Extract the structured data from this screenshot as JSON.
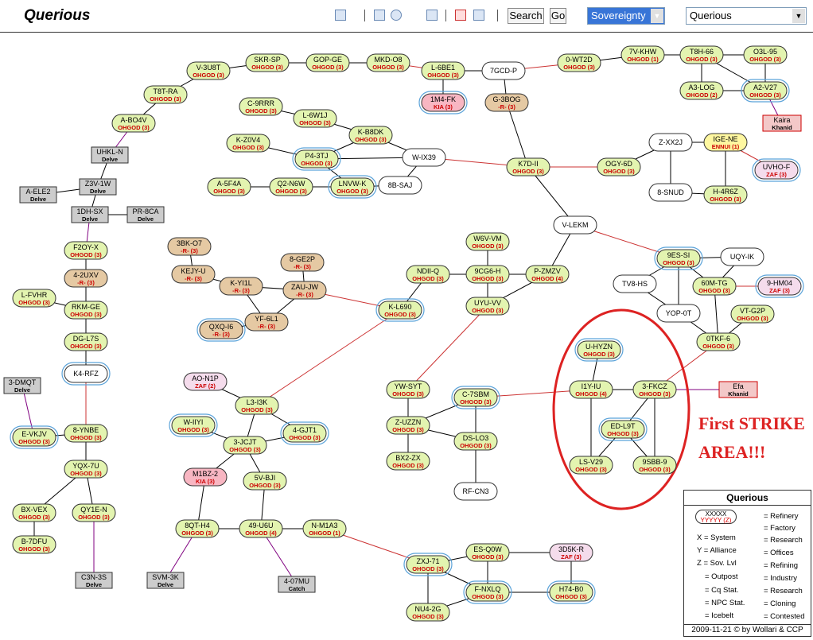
{
  "header": {
    "title": "Querious",
    "search_label": "Search",
    "go_label": "Go",
    "map_mode": "Sovereignty",
    "region_select": "Querious"
  },
  "annotation": {
    "line1": "First STRIKE",
    "line2": "AREA!!!"
  },
  "legend": {
    "title": "Querious",
    "sample_name": "XXXXX",
    "sample_ally": "YYYYY (Z)",
    "key_system": "X = System",
    "key_alliance": "Y = Alliance",
    "key_sov": "Z = Sov. Lvl",
    "key_outpost": "= Outpost",
    "key_cq": "= Cq Stat.",
    "key_npc": "= NPC Stat.",
    "key_icebelt": "= Icebelt",
    "key_refinery": "= Refinery",
    "key_factory": "= Factory",
    "key_research": "= Research",
    "key_offices": "= Offices",
    "key_refining": "= Refining",
    "key_industry": "= Industry",
    "key_research2": "= Research",
    "key_cloning": "= Cloning",
    "key_contested": "= Contested",
    "footer": "2009-11-21 © by Wollari & CCP"
  },
  "colors": {
    "ohgod": "#e3f4b0",
    "red_r": "#e5c9a3",
    "contested": "#f8b6c2",
    "zaf": "#f5dcec",
    "ennui": "#fef7a0",
    "box": "#cccccc",
    "red_line": "#cc3333",
    "purple_line": "#800080"
  },
  "systems": [
    {
      "id": "V-3U8T",
      "label": "OHGOD (3)",
      "c": "g"
    },
    {
      "id": "SKR-SP",
      "label": "OHGOD (3)",
      "c": "g"
    },
    {
      "id": "GOP-GE",
      "label": "OHGOD (3)",
      "c": "g"
    },
    {
      "id": "MKD-O8",
      "label": "OHGOD (3)",
      "c": "g"
    },
    {
      "id": "L-6BE1",
      "label": "OHGOD (3)",
      "c": "g"
    },
    {
      "id": "7GCD-P",
      "label": "",
      "c": "w"
    },
    {
      "id": "0-WT2D",
      "label": "OHGOD (3)",
      "c": "g"
    },
    {
      "id": "7V-KHW",
      "label": "OHGOD (1)",
      "c": "g"
    },
    {
      "id": "T8H-66",
      "label": "OHGOD (3)",
      "c": "g"
    },
    {
      "id": "O3L-95",
      "label": "OHGOD (3)",
      "c": "g"
    },
    {
      "id": "A3-LOG",
      "label": "OHGOD (2)",
      "c": "g"
    },
    {
      "id": "A2-V27",
      "label": "OHGOD (3)",
      "c": "g",
      "ice": 1
    },
    {
      "id": "T8T-RA",
      "label": "OHGOD (3)",
      "c": "g"
    },
    {
      "id": "A-BO4V",
      "label": "OHGOD (3)",
      "c": "g"
    },
    {
      "id": "1M4-FK",
      "label": "KIA (3)",
      "c": "p",
      "ice": 1
    },
    {
      "id": "G-3BOG",
      "label": "-R- (3)",
      "c": "r"
    },
    {
      "id": "C-9RRR",
      "label": "OHGOD (3)",
      "c": "g"
    },
    {
      "id": "L-6W1J",
      "label": "OHGOD (3)",
      "c": "g"
    },
    {
      "id": "K-B8DK",
      "label": "OHGOD (3)",
      "c": "g"
    },
    {
      "id": "K-Z0V4",
      "label": "OHGOD (3)",
      "c": "g"
    },
    {
      "id": "P4-3TJ",
      "label": "OHGOD (3)",
      "c": "g",
      "ice": 1
    },
    {
      "id": "W-IX39",
      "label": "",
      "c": "w"
    },
    {
      "id": "K7D-II",
      "label": "OHGOD (3)",
      "c": "g"
    },
    {
      "id": "Z-XX2J",
      "label": "",
      "c": "w"
    },
    {
      "id": "IGE-NE",
      "label": "ENNUI (1)",
      "c": "y"
    },
    {
      "id": "OGY-6D",
      "label": "OHGOD (3)",
      "c": "g"
    },
    {
      "id": "UVHO-F",
      "label": "ZAF (3)",
      "c": "z",
      "ice": 1
    },
    {
      "id": "A-5F4A",
      "label": "OHGOD (3)",
      "c": "g"
    },
    {
      "id": "Q2-N6W",
      "label": "OHGOD (3)",
      "c": "g"
    },
    {
      "id": "LNVW-K",
      "label": "OHGOD (3)",
      "c": "g",
      "ice": 1
    },
    {
      "id": "8B-SAJ",
      "label": "",
      "c": "w"
    },
    {
      "id": "8-SNUD",
      "label": "",
      "c": "w"
    },
    {
      "id": "H-4R6Z",
      "label": "OHGOD (3)",
      "c": "g"
    },
    {
      "id": "V-LEKM",
      "label": "",
      "c": "w"
    },
    {
      "id": "F2OY-X",
      "label": "OHGOD (3)",
      "c": "g"
    },
    {
      "id": "3BK-O7",
      "label": "-R- (3)",
      "c": "r"
    },
    {
      "id": "W6V-VM",
      "label": "OHGOD (3)",
      "c": "g"
    },
    {
      "id": "8-GE2P",
      "label": "-R- (3)",
      "c": "r"
    },
    {
      "id": "KEJY-U",
      "label": "-R- (3)",
      "c": "r"
    },
    {
      "id": "4-2UXV",
      "label": "-R- (3)",
      "c": "r"
    },
    {
      "id": "NDII-Q",
      "label": "OHGOD (3)",
      "c": "g"
    },
    {
      "id": "9CG6-H",
      "label": "OHGOD (3)",
      "c": "g"
    },
    {
      "id": "P-ZMZV",
      "label": "OHGOD (4)",
      "c": "g"
    },
    {
      "id": "9ES-SI",
      "label": "OHGOD (3)",
      "c": "g",
      "ice": 1
    },
    {
      "id": "UQY-IK",
      "label": "",
      "c": "w"
    },
    {
      "id": "K-YI1L",
      "label": "-R- (3)",
      "c": "r"
    },
    {
      "id": "ZAU-JW",
      "label": "-R- (3)",
      "c": "r"
    },
    {
      "id": "L-FVHR",
      "label": "OHGOD (3)",
      "c": "g"
    },
    {
      "id": "TV8-HS",
      "label": "",
      "c": "w"
    },
    {
      "id": "60M-TG",
      "label": "OHGOD (3)",
      "c": "g"
    },
    {
      "id": "9-HM04",
      "label": "ZAF (3)",
      "c": "z",
      "ice": 1
    },
    {
      "id": "RKM-GE",
      "label": "OHGOD (3)",
      "c": "g"
    },
    {
      "id": "UYU-VV",
      "label": "OHGOD (3)",
      "c": "g"
    },
    {
      "id": "K-L690",
      "label": "OHGOD (3)",
      "c": "g",
      "ice": 1
    },
    {
      "id": "YOP-0T",
      "label": "",
      "c": "w"
    },
    {
      "id": "VT-G2P",
      "label": "OHGOD (3)",
      "c": "g"
    },
    {
      "id": "YF-6L1",
      "label": "-R- (3)",
      "c": "r"
    },
    {
      "id": "QXQ-I6",
      "label": "-R- (3)",
      "c": "r",
      "ice": 1
    },
    {
      "id": "DG-L7S",
      "label": "OHGOD (3)",
      "c": "g"
    },
    {
      "id": "0TKF-6",
      "label": "OHGOD (3)",
      "c": "g"
    },
    {
      "id": "U-HYZN",
      "label": "OHGOD (3)",
      "c": "g",
      "ice": 1
    },
    {
      "id": "K4-RFZ",
      "label": "",
      "c": "w",
      "ice": 1
    },
    {
      "id": "AO-N1P",
      "label": "ZAF (2)",
      "c": "z"
    },
    {
      "id": "YW-SYT",
      "label": "OHGOD (3)",
      "c": "g"
    },
    {
      "id": "I1Y-IU",
      "label": "OHGOD (4)",
      "c": "g"
    },
    {
      "id": "3-FKCZ",
      "label": "OHGOD (3)",
      "c": "g"
    },
    {
      "id": "C-7SBM",
      "label": "OHGOD (3)",
      "c": "g",
      "ice": 1
    },
    {
      "id": "L3-I3K",
      "label": "OHGOD (3)",
      "c": "g"
    },
    {
      "id": "W-IIYI",
      "label": "OHGOD (3)",
      "c": "g",
      "ice": 1
    },
    {
      "id": "4-GJT1",
      "label": "OHGOD (3)",
      "c": "g",
      "ice": 1
    },
    {
      "id": "Z-UZZN",
      "label": "OHGOD (3)",
      "c": "g"
    },
    {
      "id": "E-VKJV",
      "label": "OHGOD (3)",
      "c": "g",
      "ice": 1
    },
    {
      "id": "8-YNBE",
      "label": "OHGOD (3)",
      "c": "g"
    },
    {
      "id": "ED-L9T",
      "label": "OHGOD (3)",
      "c": "g",
      "ice": 1
    },
    {
      "id": "3-JCJT",
      "label": "OHGOD (3)",
      "c": "g"
    },
    {
      "id": "DS-LO3",
      "label": "OHGOD (3)",
      "c": "g"
    },
    {
      "id": "BX2-ZX",
      "label": "OHGOD (3)",
      "c": "g"
    },
    {
      "id": "YQX-7U",
      "label": "OHGOD (3)",
      "c": "g"
    },
    {
      "id": "LS-V29",
      "label": "OHGOD (3)",
      "c": "g"
    },
    {
      "id": "9SBB-9",
      "label": "OHGOD (3)",
      "c": "g"
    },
    {
      "id": "M1BZ-2",
      "label": "KIA (3)",
      "c": "p"
    },
    {
      "id": "5V-BJI",
      "label": "OHGOD (3)",
      "c": "g"
    },
    {
      "id": "RF-CN3",
      "label": "",
      "c": "w"
    },
    {
      "id": "BX-VEX",
      "label": "OHGOD (3)",
      "c": "g"
    },
    {
      "id": "QY1E-N",
      "label": "OHGOD (3)",
      "c": "g"
    },
    {
      "id": "8QT-H4",
      "label": "OHGOD (3)",
      "c": "g"
    },
    {
      "id": "49-U6U",
      "label": "OHGOD (4)",
      "c": "g"
    },
    {
      "id": "N-M1A3",
      "label": "OHGOD (1)",
      "c": "g"
    },
    {
      "id": "B-7DFU",
      "label": "OHGOD (3)",
      "c": "g"
    },
    {
      "id": "ES-Q0W",
      "label": "OHGOD (3)",
      "c": "g"
    },
    {
      "id": "3D5K-R",
      "label": "ZAF (3)",
      "c": "z"
    },
    {
      "id": "ZXJ-71",
      "label": "OHGOD (3)",
      "c": "g",
      "ice": 1
    },
    {
      "id": "F-NXLQ",
      "label": "OHGOD (3)",
      "c": "g",
      "ice": 1
    },
    {
      "id": "H74-B0",
      "label": "OHGOD (3)",
      "c": "g",
      "ice": 1
    },
    {
      "id": "NU4-2G",
      "label": "OHGOD (3)",
      "c": "g"
    }
  ],
  "boxes": [
    {
      "id": "UHKL-N",
      "label": "Delve"
    },
    {
      "id": "A-ELE2",
      "label": "Delve"
    },
    {
      "id": "Z3V-1W",
      "label": "Delve"
    },
    {
      "id": "1DH-SX",
      "label": "Delve"
    },
    {
      "id": "PR-8CA",
      "label": "Delve"
    },
    {
      "id": "3-DMQT",
      "label": "Delve"
    },
    {
      "id": "C3N-3S",
      "label": "Delve"
    },
    {
      "id": "SVM-3K",
      "label": "Delve"
    },
    {
      "id": "4-07MU",
      "label": "Catch"
    },
    {
      "id": "Kaira",
      "label": "Khanid",
      "red": 1
    },
    {
      "id": "Efa",
      "label": "Khanid",
      "red": 1
    }
  ]
}
